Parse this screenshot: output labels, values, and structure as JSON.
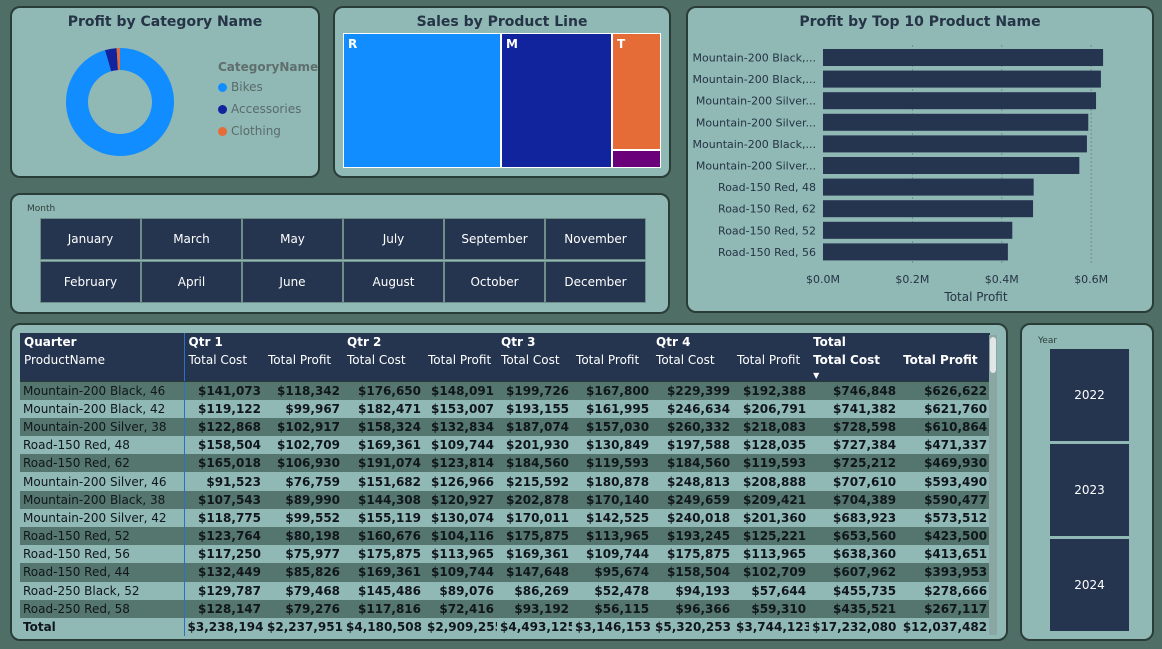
{
  "donut": {
    "title": "Profit by Category Name",
    "legend_title": "CategoryName",
    "colors": {
      "Bikes": "#118dff",
      "Accessories": "#12239e",
      "Clothing": "#e66c37"
    },
    "chart_data": {
      "type": "pie",
      "title": "Profit by Category Name",
      "categories": [
        "Bikes",
        "Accessories",
        "Clothing"
      ],
      "values": [
        95.5,
        3.5,
        1.0
      ]
    }
  },
  "treemap": {
    "title": "Sales by Product Line",
    "chart_data": {
      "type": "heatmap",
      "title": "Sales by Product Line",
      "categories": [
        "R",
        "M",
        "T",
        ""
      ],
      "values": [
        49,
        34,
        14,
        3
      ],
      "colors": [
        "#118dff",
        "#12239e",
        "#e66c37",
        "#6b007b"
      ]
    }
  },
  "bars": {
    "title": "Profit by Top 10 Product Name",
    "xlabel": "Total Profit",
    "bar_color": "#253550",
    "chart_data": {
      "type": "bar",
      "title": "Profit by Top 10 Product Name",
      "xlabel": "Total Profit",
      "ylabel": "",
      "categories": [
        "Mountain-200 Black,...",
        "Mountain-200 Black,...",
        "Mountain-200 Silver...",
        "Mountain-200 Silver...",
        "Mountain-200 Black,...",
        "Mountain-200 Silver...",
        "Road-150 Red, 48",
        "Road-150 Red, 62",
        "Road-150 Red, 52",
        "Road-150 Red, 56"
      ],
      "values": [
        0.626622,
        0.62176,
        0.610864,
        0.59349,
        0.590477,
        0.573512,
        0.471337,
        0.46993,
        0.4235,
        0.413651
      ],
      "xlim": [
        0,
        0.66
      ],
      "ticks": [
        "$0.0M",
        "$0.2M",
        "$0.4M",
        "$0.6M"
      ],
      "tick_values": [
        0,
        0.2,
        0.4,
        0.6
      ]
    }
  },
  "month_slicer": {
    "label": "Month",
    "row1": [
      "January",
      "March",
      "May",
      "July",
      "September",
      "November"
    ],
    "row2": [
      "February",
      "April",
      "June",
      "August",
      "October",
      "December"
    ]
  },
  "matrix": {
    "row_header_1": "Quarter",
    "row_header_2": "ProductName",
    "quarters": [
      "Qtr 1",
      "Qtr 2",
      "Qtr 3",
      "Qtr 4",
      "Total"
    ],
    "col_cost": "Total Cost",
    "col_profit": "Total Profit",
    "rows": [
      [
        "Mountain-200 Black, 46",
        "$141,073",
        "$118,342",
        "$176,650",
        "$148,091",
        "$199,726",
        "$167,800",
        "$229,399",
        "$192,388",
        "$746,848",
        "$626,622"
      ],
      [
        "Mountain-200 Black, 42",
        "$119,122",
        "$99,967",
        "$182,471",
        "$153,007",
        "$193,155",
        "$161,995",
        "$246,634",
        "$206,791",
        "$741,382",
        "$621,760"
      ],
      [
        "Mountain-200 Silver, 38",
        "$122,868",
        "$102,917",
        "$158,324",
        "$132,834",
        "$187,074",
        "$157,030",
        "$260,332",
        "$218,083",
        "$728,598",
        "$610,864"
      ],
      [
        "Road-150 Red, 48",
        "$158,504",
        "$102,709",
        "$169,361",
        "$109,744",
        "$201,930",
        "$130,849",
        "$197,588",
        "$128,035",
        "$727,384",
        "$471,337"
      ],
      [
        "Road-150 Red, 62",
        "$165,018",
        "$106,930",
        "$191,074",
        "$123,814",
        "$184,560",
        "$119,593",
        "$184,560",
        "$119,593",
        "$725,212",
        "$469,930"
      ],
      [
        "Mountain-200 Silver, 46",
        "$91,523",
        "$76,759",
        "$151,682",
        "$126,966",
        "$215,592",
        "$180,878",
        "$248,813",
        "$208,888",
        "$707,610",
        "$593,490"
      ],
      [
        "Mountain-200 Black, 38",
        "$107,543",
        "$89,990",
        "$144,308",
        "$120,927",
        "$202,878",
        "$170,140",
        "$249,659",
        "$209,421",
        "$704,389",
        "$590,477"
      ],
      [
        "Mountain-200 Silver, 42",
        "$118,775",
        "$99,552",
        "$155,119",
        "$130,074",
        "$170,011",
        "$142,525",
        "$240,018",
        "$201,360",
        "$683,923",
        "$573,512"
      ],
      [
        "Road-150 Red, 52",
        "$123,764",
        "$80,198",
        "$160,676",
        "$104,116",
        "$175,875",
        "$113,965",
        "$193,245",
        "$125,221",
        "$653,560",
        "$423,500"
      ],
      [
        "Road-150 Red, 56",
        "$117,250",
        "$75,977",
        "$175,875",
        "$113,965",
        "$169,361",
        "$109,744",
        "$175,875",
        "$113,965",
        "$638,360",
        "$413,651"
      ],
      [
        "Road-150 Red, 44",
        "$132,449",
        "$85,826",
        "$169,361",
        "$109,744",
        "$147,648",
        "$95,674",
        "$158,504",
        "$102,709",
        "$607,962",
        "$393,953"
      ],
      [
        "Road-250 Black, 52",
        "$129,787",
        "$79,468",
        "$145,486",
        "$89,076",
        "$86,269",
        "$52,478",
        "$94,193",
        "$57,644",
        "$455,735",
        "$278,666"
      ],
      [
        "Road-250 Red, 58",
        "$128,147",
        "$79,276",
        "$117,816",
        "$72,416",
        "$93,192",
        "$56,115",
        "$96,366",
        "$59,310",
        "$435,521",
        "$267,117"
      ]
    ],
    "total": [
      "Total",
      "$3,238,194",
      "$2,237,951",
      "$4,180,508",
      "$2,909,255",
      "$4,493,125",
      "$3,146,153",
      "$5,320,253",
      "$3,744,123",
      "$17,232,080",
      "$12,037,482"
    ]
  },
  "year_slicer": {
    "label": "Year",
    "years": [
      "2022",
      "2023",
      "2024"
    ]
  }
}
